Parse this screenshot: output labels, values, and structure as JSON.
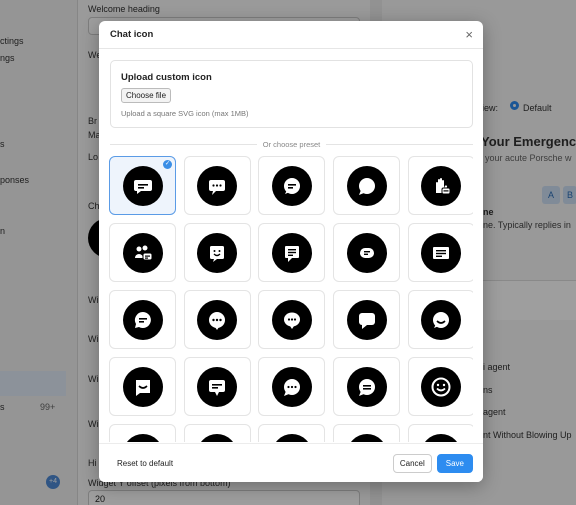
{
  "background": {
    "left_nav": [
      "ctings",
      "ngs",
      "s",
      "ponses",
      "n",
      "s",
      "99+"
    ],
    "form_labels": [
      "Welcome heading",
      "We",
      "Br",
      "Ma",
      "Lo",
      "Ch",
      "Wi",
      "Wi",
      "Wi",
      "Wi",
      "Hi",
      "Widget Y offset (pixels from bottom)"
    ],
    "y_offset_value": "20",
    "right": {
      "view_label": "iew:",
      "default_label": "Default",
      "emergency_heading": "Your Emergency",
      "emergency_sub": "your acute Porsche w",
      "chip_a": "A",
      "chip_b": "B",
      "name_tail": "ne",
      "reply_text": "ne. Typically replies in",
      "rows": [
        "i agent",
        "ns",
        "agent",
        "nt Without Blowing Up"
      ]
    },
    "avatars_more": "+4"
  },
  "modal": {
    "title": "Chat icon",
    "close_label": "×",
    "upload": {
      "title": "Upload custom icon",
      "button": "Choose file",
      "hint": "Upload a square SVG icon (max 1MB)"
    },
    "divider_text": "Or choose preset",
    "presets": [
      {
        "icon": "chat-bubble-lines-icon",
        "selected": true
      },
      {
        "icon": "chat-bubble-dots-icon",
        "selected": false
      },
      {
        "icon": "chat-round-lines-icon",
        "selected": false
      },
      {
        "icon": "chat-round-plain-icon",
        "selected": false
      },
      {
        "icon": "hand-chat-icon",
        "selected": false
      },
      {
        "icon": "people-chat-icon",
        "selected": false
      },
      {
        "icon": "smile-screen-icon",
        "selected": false
      },
      {
        "icon": "chat-square-lines-icon",
        "selected": false
      },
      {
        "icon": "chat-pill-icon",
        "selected": false
      },
      {
        "icon": "chat-window-lines-icon",
        "selected": false
      },
      {
        "icon": "chat-bubble-left-lines-icon",
        "selected": false
      },
      {
        "icon": "chat-round-dots-icon",
        "selected": false
      },
      {
        "icon": "chat-oval-dots-icon",
        "selected": false
      },
      {
        "icon": "chat-square-plain-icon",
        "selected": false
      },
      {
        "icon": "chat-smile-bubble-icon",
        "selected": false
      },
      {
        "icon": "chat-smile-square-icon",
        "selected": false
      },
      {
        "icon": "chat-bubble-lines-2-icon",
        "selected": false
      },
      {
        "icon": "chat-round-dots-2-icon",
        "selected": false
      },
      {
        "icon": "chat-round-lines-2-icon",
        "selected": false
      },
      {
        "icon": "smiley-face-icon",
        "selected": false
      },
      {
        "icon": "chat-partial-1-icon",
        "selected": false
      },
      {
        "icon": "chat-partial-2-icon",
        "selected": false
      },
      {
        "icon": "chat-partial-3-icon",
        "selected": false
      },
      {
        "icon": "chat-partial-4-icon",
        "selected": false
      },
      {
        "icon": "chat-partial-5-icon",
        "selected": false
      }
    ],
    "footer": {
      "reset": "Reset to default",
      "cancel": "Cancel",
      "save": "Save"
    }
  },
  "colors": {
    "accent": "#2d8cf0",
    "selected_border": "#5a9be6",
    "icon_fill": "#000000"
  }
}
